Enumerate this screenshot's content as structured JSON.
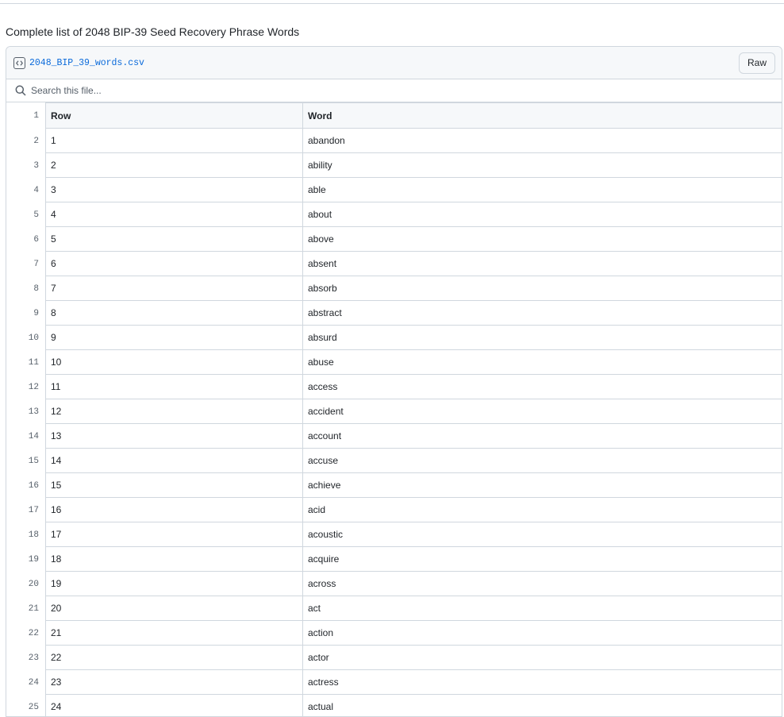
{
  "caption": "Complete list of 2048 BIP-39 Seed Recovery Phrase Words",
  "file": {
    "name": "2048_BIP_39_words.csv",
    "raw_label": "Raw",
    "icon": "code-square-icon"
  },
  "search": {
    "placeholder": "Search this file..."
  },
  "table": {
    "header_line": "1",
    "columns": [
      "Row",
      "Word"
    ],
    "rows": [
      {
        "line": "2",
        "row": "1",
        "word": "abandon"
      },
      {
        "line": "3",
        "row": "2",
        "word": "ability"
      },
      {
        "line": "4",
        "row": "3",
        "word": "able"
      },
      {
        "line": "5",
        "row": "4",
        "word": "about"
      },
      {
        "line": "6",
        "row": "5",
        "word": "above"
      },
      {
        "line": "7",
        "row": "6",
        "word": "absent"
      },
      {
        "line": "8",
        "row": "7",
        "word": "absorb"
      },
      {
        "line": "9",
        "row": "8",
        "word": "abstract"
      },
      {
        "line": "10",
        "row": "9",
        "word": "absurd"
      },
      {
        "line": "11",
        "row": "10",
        "word": "abuse"
      },
      {
        "line": "12",
        "row": "11",
        "word": "access"
      },
      {
        "line": "13",
        "row": "12",
        "word": "accident"
      },
      {
        "line": "14",
        "row": "13",
        "word": "account"
      },
      {
        "line": "15",
        "row": "14",
        "word": "accuse"
      },
      {
        "line": "16",
        "row": "15",
        "word": "achieve"
      },
      {
        "line": "17",
        "row": "16",
        "word": "acid"
      },
      {
        "line": "18",
        "row": "17",
        "word": "acoustic"
      },
      {
        "line": "19",
        "row": "18",
        "word": "acquire"
      },
      {
        "line": "20",
        "row": "19",
        "word": "across"
      },
      {
        "line": "21",
        "row": "20",
        "word": "act"
      },
      {
        "line": "22",
        "row": "21",
        "word": "action"
      },
      {
        "line": "23",
        "row": "22",
        "word": "actor"
      },
      {
        "line": "24",
        "row": "23",
        "word": "actress"
      },
      {
        "line": "25",
        "row": "24",
        "word": "actual"
      }
    ]
  }
}
